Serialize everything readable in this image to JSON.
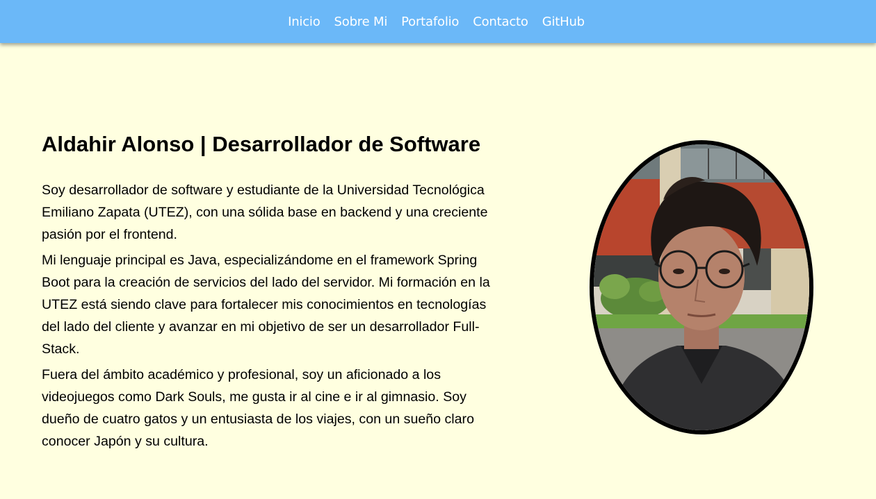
{
  "nav": {
    "items": [
      {
        "label": "Inicio"
      },
      {
        "label": "Sobre Mi"
      },
      {
        "label": "Portafolio"
      },
      {
        "label": "Contacto"
      },
      {
        "label": "GitHub"
      }
    ]
  },
  "about": {
    "title": "Aldahir Alonso | Desarrollador de Software",
    "paragraphs": [
      "Soy desarrollador de software y estudiante de la Universidad Tecnológica Emiliano Zapata (UTEZ), con una sólida base en backend y una creciente pasión por el frontend.",
      "Mi lenguaje principal es Java, especializándome en el framework Spring Boot para la creación de servicios del lado del servidor. Mi formación en la UTEZ está siendo clave para fortalecer mis conocimientos en tecnologías del lado del cliente y avanzar en mi objetivo de ser un desarrollador Full-Stack.",
      "Fuera del ámbito académico y profesional, soy un aficionado a los videojuegos como Dark Souls, me gusta ir al cine e ir al gimnasio. Soy dueño de cuatro gatos y un entusiasta de los viajes, con un sueño claro conocer Japón y su cultura."
    ]
  },
  "colors": {
    "page_background": "#FFFFE0",
    "navbar_background": "#6BB8F8",
    "nav_text": "#FFFFFF",
    "text": "#000000"
  }
}
